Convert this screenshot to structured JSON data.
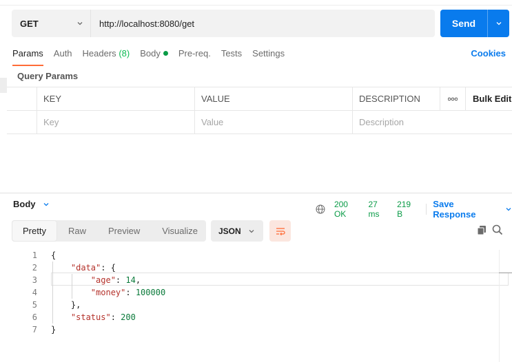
{
  "request": {
    "method": "GET",
    "url": "http://localhost:8080/get",
    "send_label": "Send"
  },
  "tabs": {
    "params": "Params",
    "auth": "Auth",
    "headers": "Headers",
    "headers_count": "(8)",
    "body": "Body",
    "prereq": "Pre-req.",
    "tests": "Tests",
    "settings": "Settings",
    "cookies": "Cookies"
  },
  "query_params": {
    "title": "Query Params",
    "columns": [
      "KEY",
      "VALUE",
      "DESCRIPTION"
    ],
    "more": "ooo",
    "bulk_edit": "Bulk Edit",
    "placeholders": {
      "key": "Key",
      "value": "Value",
      "description": "Description"
    }
  },
  "response": {
    "section_label": "Body",
    "status": "200 OK",
    "time": "27 ms",
    "size": "219 B",
    "save_label": "Save Response",
    "views": [
      "Pretty",
      "Raw",
      "Preview",
      "Visualize"
    ],
    "active_view": "Pretty",
    "format": "JSON",
    "lines": [
      {
        "n": "1",
        "segments": [
          {
            "t": "{",
            "c": "p"
          }
        ]
      },
      {
        "n": "2",
        "segments": [
          {
            "t": "    ",
            "c": "p"
          },
          {
            "t": "\"data\"",
            "c": "k"
          },
          {
            "t": ": {",
            "c": "p"
          }
        ]
      },
      {
        "n": "3",
        "segments": [
          {
            "t": "        ",
            "c": "p"
          },
          {
            "t": "\"age\"",
            "c": "k"
          },
          {
            "t": ": ",
            "c": "p"
          },
          {
            "t": "14",
            "c": "n"
          },
          {
            "t": ",",
            "c": "p"
          }
        ]
      },
      {
        "n": "4",
        "segments": [
          {
            "t": "        ",
            "c": "p"
          },
          {
            "t": "\"money\"",
            "c": "k"
          },
          {
            "t": ": ",
            "c": "p"
          },
          {
            "t": "100000",
            "c": "n"
          }
        ]
      },
      {
        "n": "5",
        "segments": [
          {
            "t": "    },",
            "c": "p"
          }
        ]
      },
      {
        "n": "6",
        "segments": [
          {
            "t": "    ",
            "c": "p"
          },
          {
            "t": "\"status\"",
            "c": "k"
          },
          {
            "t": ": ",
            "c": "p"
          },
          {
            "t": "200",
            "c": "n"
          }
        ]
      },
      {
        "n": "7",
        "segments": [
          {
            "t": "}",
            "c": "p"
          }
        ]
      }
    ]
  },
  "colors": {
    "accent": "#097bed",
    "tab_active": "#ff6c37",
    "status_ok": "#0a9b47",
    "json_key": "#b4312a",
    "json_number": "#0a7a3a"
  },
  "icons": {
    "method_dropdown": "chevron-down-icon",
    "send_dropdown": "chevron-down-icon",
    "body_dot": "status-dot-icon",
    "globe": "globe-icon",
    "save_dropdown": "chevron-down-icon",
    "format_dropdown": "chevron-down-icon",
    "wrap": "wrap-lines-icon",
    "copy": "copy-icon",
    "search": "search-icon"
  }
}
